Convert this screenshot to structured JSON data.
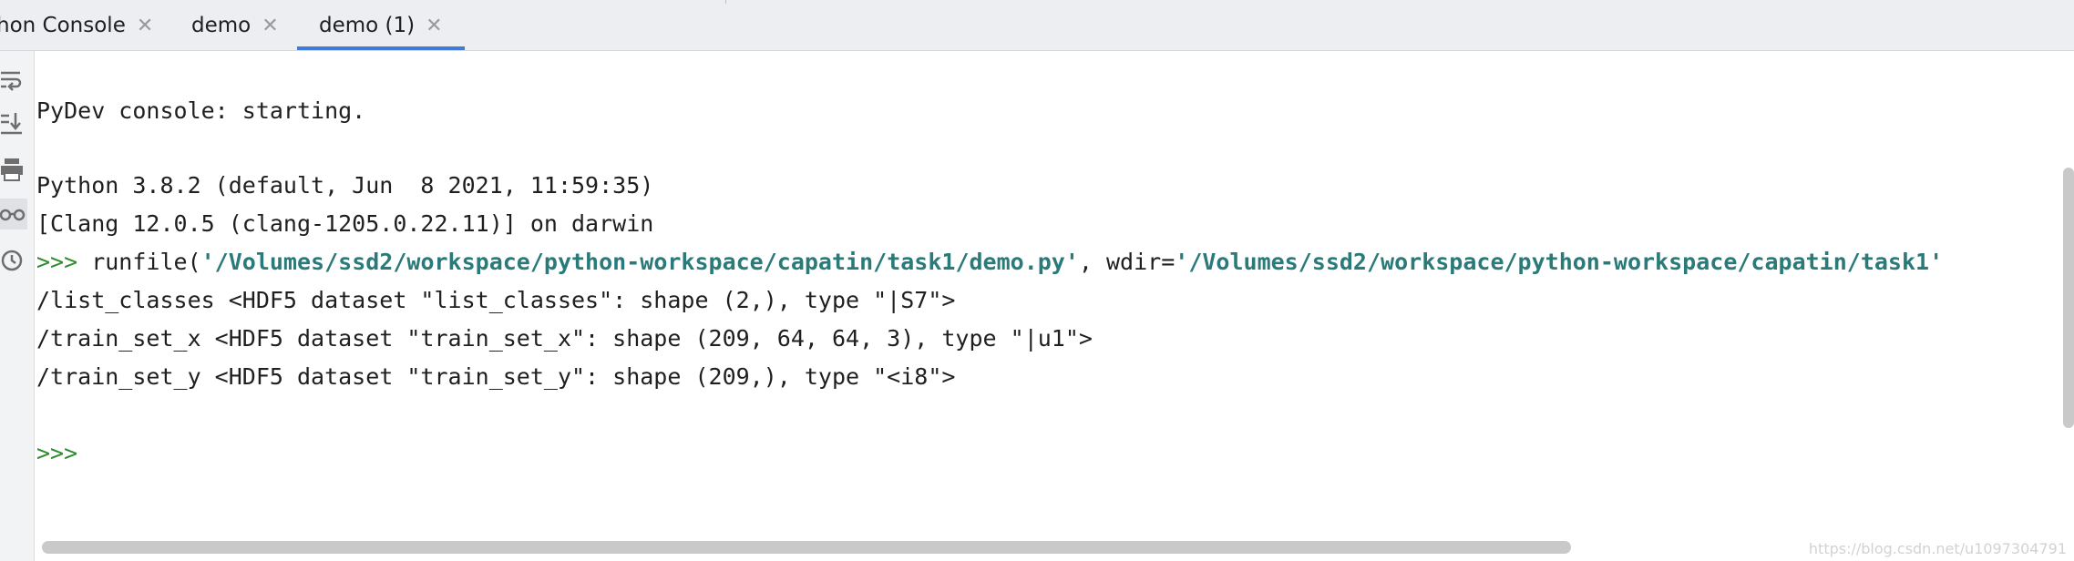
{
  "tabs": [
    {
      "label": "hon Console",
      "close": "✕",
      "active": false
    },
    {
      "label": "demo",
      "close": "✕",
      "active": false
    },
    {
      "label": "demo (1)",
      "close": "✕",
      "active": true
    }
  ],
  "gutter_icons": [
    "soft-wrap-icon",
    "scroll-to-end-icon",
    "print-icon",
    "show-variables-icon",
    "history-icon"
  ],
  "console": {
    "starting": "PyDev console: starting.",
    "python_version": "Python 3.8.2 (default, Jun  8 2021, 11:59:35)",
    "clang": "[Clang 12.0.5 (clang-1205.0.22.11)] on darwin",
    "prompt": ">>>",
    "runfile_open": " runfile(",
    "runfile_path": "'/Volumes/ssd2/workspace/python-workspace/capatin/task1/demo.py'",
    "runfile_mid": ", wdir=",
    "runfile_wdir": "'/Volumes/ssd2/workspace/python-workspace/capatin/task1'",
    "output1": "/list_classes <HDF5 dataset \"list_classes\": shape (2,), type \"|S7\">",
    "output2": "/train_set_x <HDF5 dataset \"train_set_x\": shape (209, 64, 64, 3), type \"|u1\">",
    "output3": "/train_set_y <HDF5 dataset \"train_set_y\": shape (209,), type \"<i8\">",
    "final_prompt": ">>>"
  },
  "watermark": "https://blog.csdn.net/u1097304791",
  "colors": {
    "accent": "#3f7cd9",
    "prompt": "#2e8b2e",
    "string": "#2a7a7a"
  }
}
